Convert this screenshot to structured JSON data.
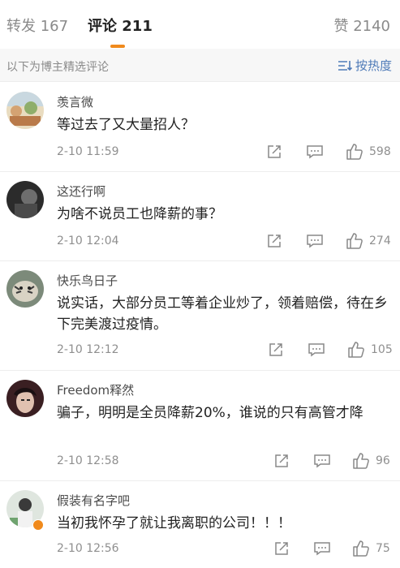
{
  "tabs": {
    "repost_label": "转发",
    "repost_count": "167",
    "comment_label": "评论",
    "comment_count": "211",
    "like_label": "赞",
    "like_count": "2140"
  },
  "subbar": {
    "note": "以下为博主精选评论",
    "sort_label": "按热度"
  },
  "comments": [
    {
      "user": "羡言微",
      "text": "等过去了又大量招人？",
      "time": "2-10 11:59",
      "likes": "598"
    },
    {
      "user": "这还行啊",
      "text": "为啥不说员工也降薪的事？",
      "time": "2-10 12:04",
      "likes": "274"
    },
    {
      "user": "快乐鸟日子",
      "text": "说实话，大部分员工等着企业炒了，领着赔偿，待在乡下完美渡过疫情。",
      "time": "2-10 12:12",
      "likes": "105"
    },
    {
      "user": "Freedom释然",
      "text": "骗子，明明是全员降薪20%，谁说的只有高管才降",
      "time": "2-10 12:58",
      "likes": "96"
    },
    {
      "user": "假装有名字吧",
      "text": "当初我怀孕了就让我离职的公司！！！",
      "time": "2-10 12:56",
      "likes": "75"
    }
  ],
  "icons": {
    "share": "share-icon",
    "reply": "comment-icon",
    "like": "thumbs-up-icon",
    "sort": "sort-icon"
  },
  "colors": {
    "accent": "#f08a1c",
    "link": "#4f7bb8"
  }
}
